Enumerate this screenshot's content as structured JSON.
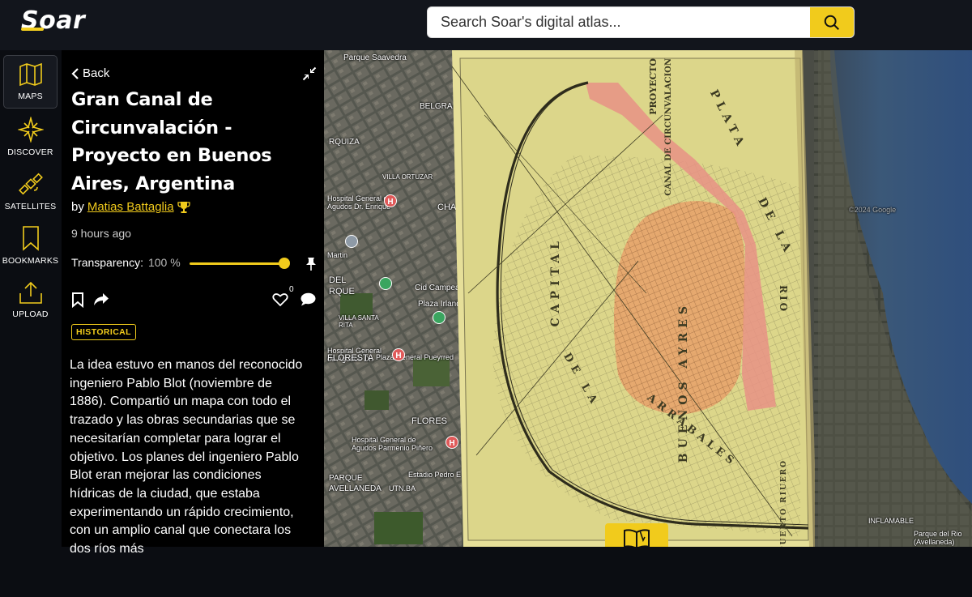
{
  "brand": {
    "name": "Soar",
    "accent": "#f1cb1c"
  },
  "search": {
    "placeholder": "Search Soar's digital atlas...",
    "icon": "search-icon"
  },
  "nav": [
    {
      "label": "MAPS",
      "icon": "map-icon",
      "active": true
    },
    {
      "label": "DISCOVER",
      "icon": "compass-star-icon",
      "active": false
    },
    {
      "label": "SATELLITES",
      "icon": "satellite-icon",
      "active": false
    },
    {
      "label": "BOOKMARKS",
      "icon": "bookmark-icon",
      "active": false
    },
    {
      "label": "UPLOAD",
      "icon": "upload-icon",
      "active": false
    }
  ],
  "panel": {
    "back_label": "Back",
    "title": "Gran Canal de Circunvalación - Proyecto en Buenos Aires, Argentina",
    "by_prefix": "by",
    "author": "Matias Battaglia",
    "posted": "9 hours ago",
    "transparency_label": "Transparency:",
    "transparency_value": "100 %",
    "transparency_level": 1.0,
    "likes": "0",
    "tag": "HISTORICAL",
    "description": "La idea estuvo en manos del reconocido ingeniero Pablo Blot (noviembre de 1886). Compartió un mapa con todo el trazado y las obras secundarias que se necesitarían completar para lograr el objetivo. Los planes del ingeniero Pablo Blot eran mejorar las condiciones hídricas de la ciudad, que estaba experimentando un rápido crecimiento, con un amplio canal que conectara los dos ríos más"
  },
  "map": {
    "labels": [
      "Parque Saavedra",
      "BELGRA",
      "RQUIZA",
      "VILLA ORTUZAR",
      "Hospital General de Agudos Dr. Enrique",
      "CHACA",
      "Martin",
      "DEL",
      "RQUE",
      "Cid Campea",
      "Plaza Irland",
      "VILLA SANTA RITA",
      "Hospital General de Agudos Dr.",
      "FLORESTA",
      "Plaza General Pueyrred",
      "FLORES",
      "Hospital General de Agudos Parmenio Piñero",
      "PARQUE AVELLANEDA",
      "UTN.BA",
      "Estadio Pedro E",
      "©2024 Google",
      "INFLAMABLE",
      "Parque del Rio (Avellaneda)"
    ],
    "scan_labels": [
      "PROYECTO",
      "CANAL DE CIRCUNVALACION",
      "PLATA",
      "DE LA",
      "RIO",
      "BUENOS AYRES",
      "CAPITAL",
      "DE LA",
      "ARRABALES",
      "PUERTO RIUERO"
    ]
  }
}
